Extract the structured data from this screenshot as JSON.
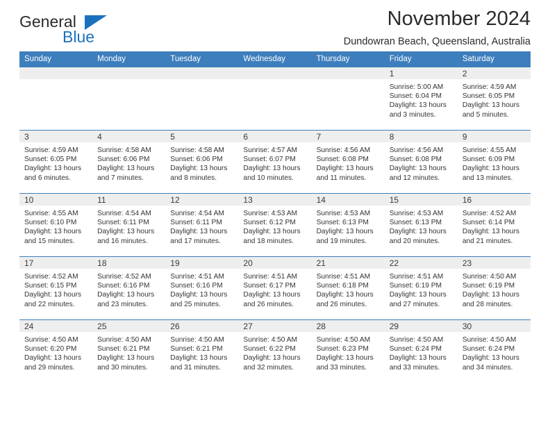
{
  "brand": {
    "name_part1": "General",
    "name_part2": "Blue",
    "logo_icon": "blue-triangle-logo",
    "accent_color": "#1b72bc"
  },
  "header": {
    "title": "November 2024",
    "subtitle": "Dundowran Beach, Queensland, Australia"
  },
  "calendar": {
    "header_color": "#3d7ebd",
    "daynum_band_color": "#eeeeee",
    "weekday_headers": [
      "Sunday",
      "Monday",
      "Tuesday",
      "Wednesday",
      "Thursday",
      "Friday",
      "Saturday"
    ],
    "weeks": [
      [
        {
          "day": "",
          "sunrise": "",
          "sunset": "",
          "daylight_line1": "",
          "daylight_line2": "",
          "empty": true
        },
        {
          "day": "",
          "sunrise": "",
          "sunset": "",
          "daylight_line1": "",
          "daylight_line2": "",
          "empty": true
        },
        {
          "day": "",
          "sunrise": "",
          "sunset": "",
          "daylight_line1": "",
          "daylight_line2": "",
          "empty": true
        },
        {
          "day": "",
          "sunrise": "",
          "sunset": "",
          "daylight_line1": "",
          "daylight_line2": "",
          "empty": true
        },
        {
          "day": "",
          "sunrise": "",
          "sunset": "",
          "daylight_line1": "",
          "daylight_line2": "",
          "empty": true
        },
        {
          "day": "1",
          "sunrise": "Sunrise: 5:00 AM",
          "sunset": "Sunset: 6:04 PM",
          "daylight_line1": "Daylight: 13 hours",
          "daylight_line2": "and 3 minutes."
        },
        {
          "day": "2",
          "sunrise": "Sunrise: 4:59 AM",
          "sunset": "Sunset: 6:05 PM",
          "daylight_line1": "Daylight: 13 hours",
          "daylight_line2": "and 5 minutes."
        }
      ],
      [
        {
          "day": "3",
          "sunrise": "Sunrise: 4:59 AM",
          "sunset": "Sunset: 6:05 PM",
          "daylight_line1": "Daylight: 13 hours",
          "daylight_line2": "and 6 minutes."
        },
        {
          "day": "4",
          "sunrise": "Sunrise: 4:58 AM",
          "sunset": "Sunset: 6:06 PM",
          "daylight_line1": "Daylight: 13 hours",
          "daylight_line2": "and 7 minutes."
        },
        {
          "day": "5",
          "sunrise": "Sunrise: 4:58 AM",
          "sunset": "Sunset: 6:06 PM",
          "daylight_line1": "Daylight: 13 hours",
          "daylight_line2": "and 8 minutes."
        },
        {
          "day": "6",
          "sunrise": "Sunrise: 4:57 AM",
          "sunset": "Sunset: 6:07 PM",
          "daylight_line1": "Daylight: 13 hours",
          "daylight_line2": "and 10 minutes."
        },
        {
          "day": "7",
          "sunrise": "Sunrise: 4:56 AM",
          "sunset": "Sunset: 6:08 PM",
          "daylight_line1": "Daylight: 13 hours",
          "daylight_line2": "and 11 minutes."
        },
        {
          "day": "8",
          "sunrise": "Sunrise: 4:56 AM",
          "sunset": "Sunset: 6:08 PM",
          "daylight_line1": "Daylight: 13 hours",
          "daylight_line2": "and 12 minutes."
        },
        {
          "day": "9",
          "sunrise": "Sunrise: 4:55 AM",
          "sunset": "Sunset: 6:09 PM",
          "daylight_line1": "Daylight: 13 hours",
          "daylight_line2": "and 13 minutes."
        }
      ],
      [
        {
          "day": "10",
          "sunrise": "Sunrise: 4:55 AM",
          "sunset": "Sunset: 6:10 PM",
          "daylight_line1": "Daylight: 13 hours",
          "daylight_line2": "and 15 minutes."
        },
        {
          "day": "11",
          "sunrise": "Sunrise: 4:54 AM",
          "sunset": "Sunset: 6:11 PM",
          "daylight_line1": "Daylight: 13 hours",
          "daylight_line2": "and 16 minutes."
        },
        {
          "day": "12",
          "sunrise": "Sunrise: 4:54 AM",
          "sunset": "Sunset: 6:11 PM",
          "daylight_line1": "Daylight: 13 hours",
          "daylight_line2": "and 17 minutes."
        },
        {
          "day": "13",
          "sunrise": "Sunrise: 4:53 AM",
          "sunset": "Sunset: 6:12 PM",
          "daylight_line1": "Daylight: 13 hours",
          "daylight_line2": "and 18 minutes."
        },
        {
          "day": "14",
          "sunrise": "Sunrise: 4:53 AM",
          "sunset": "Sunset: 6:13 PM",
          "daylight_line1": "Daylight: 13 hours",
          "daylight_line2": "and 19 minutes."
        },
        {
          "day": "15",
          "sunrise": "Sunrise: 4:53 AM",
          "sunset": "Sunset: 6:13 PM",
          "daylight_line1": "Daylight: 13 hours",
          "daylight_line2": "and 20 minutes."
        },
        {
          "day": "16",
          "sunrise": "Sunrise: 4:52 AM",
          "sunset": "Sunset: 6:14 PM",
          "daylight_line1": "Daylight: 13 hours",
          "daylight_line2": "and 21 minutes."
        }
      ],
      [
        {
          "day": "17",
          "sunrise": "Sunrise: 4:52 AM",
          "sunset": "Sunset: 6:15 PM",
          "daylight_line1": "Daylight: 13 hours",
          "daylight_line2": "and 22 minutes."
        },
        {
          "day": "18",
          "sunrise": "Sunrise: 4:52 AM",
          "sunset": "Sunset: 6:16 PM",
          "daylight_line1": "Daylight: 13 hours",
          "daylight_line2": "and 23 minutes."
        },
        {
          "day": "19",
          "sunrise": "Sunrise: 4:51 AM",
          "sunset": "Sunset: 6:16 PM",
          "daylight_line1": "Daylight: 13 hours",
          "daylight_line2": "and 25 minutes."
        },
        {
          "day": "20",
          "sunrise": "Sunrise: 4:51 AM",
          "sunset": "Sunset: 6:17 PM",
          "daylight_line1": "Daylight: 13 hours",
          "daylight_line2": "and 26 minutes."
        },
        {
          "day": "21",
          "sunrise": "Sunrise: 4:51 AM",
          "sunset": "Sunset: 6:18 PM",
          "daylight_line1": "Daylight: 13 hours",
          "daylight_line2": "and 26 minutes."
        },
        {
          "day": "22",
          "sunrise": "Sunrise: 4:51 AM",
          "sunset": "Sunset: 6:19 PM",
          "daylight_line1": "Daylight: 13 hours",
          "daylight_line2": "and 27 minutes."
        },
        {
          "day": "23",
          "sunrise": "Sunrise: 4:50 AM",
          "sunset": "Sunset: 6:19 PM",
          "daylight_line1": "Daylight: 13 hours",
          "daylight_line2": "and 28 minutes."
        }
      ],
      [
        {
          "day": "24",
          "sunrise": "Sunrise: 4:50 AM",
          "sunset": "Sunset: 6:20 PM",
          "daylight_line1": "Daylight: 13 hours",
          "daylight_line2": "and 29 minutes."
        },
        {
          "day": "25",
          "sunrise": "Sunrise: 4:50 AM",
          "sunset": "Sunset: 6:21 PM",
          "daylight_line1": "Daylight: 13 hours",
          "daylight_line2": "and 30 minutes."
        },
        {
          "day": "26",
          "sunrise": "Sunrise: 4:50 AM",
          "sunset": "Sunset: 6:21 PM",
          "daylight_line1": "Daylight: 13 hours",
          "daylight_line2": "and 31 minutes."
        },
        {
          "day": "27",
          "sunrise": "Sunrise: 4:50 AM",
          "sunset": "Sunset: 6:22 PM",
          "daylight_line1": "Daylight: 13 hours",
          "daylight_line2": "and 32 minutes."
        },
        {
          "day": "28",
          "sunrise": "Sunrise: 4:50 AM",
          "sunset": "Sunset: 6:23 PM",
          "daylight_line1": "Daylight: 13 hours",
          "daylight_line2": "and 33 minutes."
        },
        {
          "day": "29",
          "sunrise": "Sunrise: 4:50 AM",
          "sunset": "Sunset: 6:24 PM",
          "daylight_line1": "Daylight: 13 hours",
          "daylight_line2": "and 33 minutes."
        },
        {
          "day": "30",
          "sunrise": "Sunrise: 4:50 AM",
          "sunset": "Sunset: 6:24 PM",
          "daylight_line1": "Daylight: 13 hours",
          "daylight_line2": "and 34 minutes."
        }
      ]
    ]
  }
}
